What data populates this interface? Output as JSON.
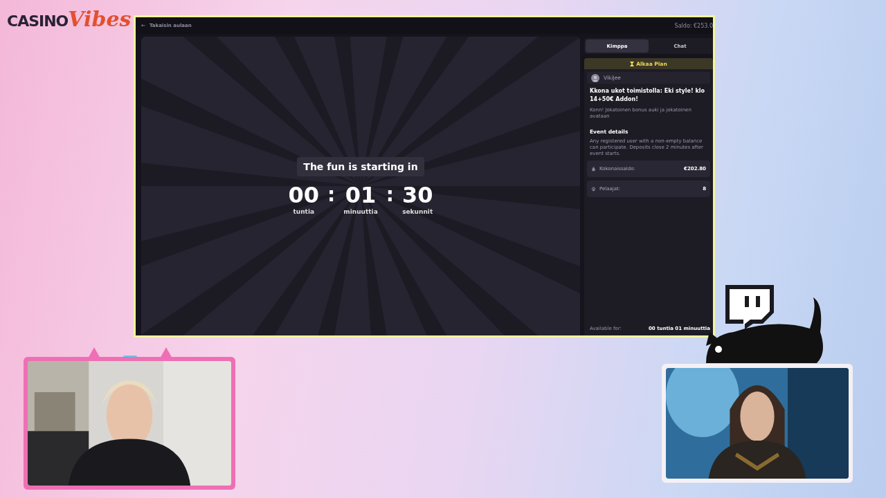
{
  "logo": {
    "first": "CASINO",
    "second": "Vibes"
  },
  "game_window": {
    "back_link": "Takaisin aulaan",
    "back_arrow": "←",
    "balance": "Saldo: €253.0",
    "countdown": {
      "title": "The fun is starting in",
      "separator": ":",
      "units": [
        {
          "value": "00",
          "label": "tuntia"
        },
        {
          "value": "01",
          "label": "minuuttia"
        },
        {
          "value": "30",
          "label": "sekunnit"
        }
      ]
    },
    "sidebar": {
      "tabs": [
        {
          "label": "Kimppa",
          "selected": true
        },
        {
          "label": "Chat",
          "selected": false
        }
      ],
      "status_banner": "Alkaa Pian",
      "host": "VikiJee",
      "event_title": "Kkona ukot toimistolla: Eki style! klo 14+50€ Addon!",
      "event_subtitle": "Konn! Jokatoinen bonus auki ja jokatoinen avataan",
      "details_heading": "Event details",
      "details_text": "Any registered user with a non-empty balance can participate. Deposits close 2 minutes after event starts.",
      "stats": [
        {
          "kind": "money",
          "label": "Kokonaissaldo:",
          "value": "€202.80"
        },
        {
          "kind": "players",
          "label": "Pelaajat:",
          "value": "8"
        }
      ],
      "available_label": "Available for:",
      "available_value": "00 tuntia 01 minuuttia"
    }
  }
}
